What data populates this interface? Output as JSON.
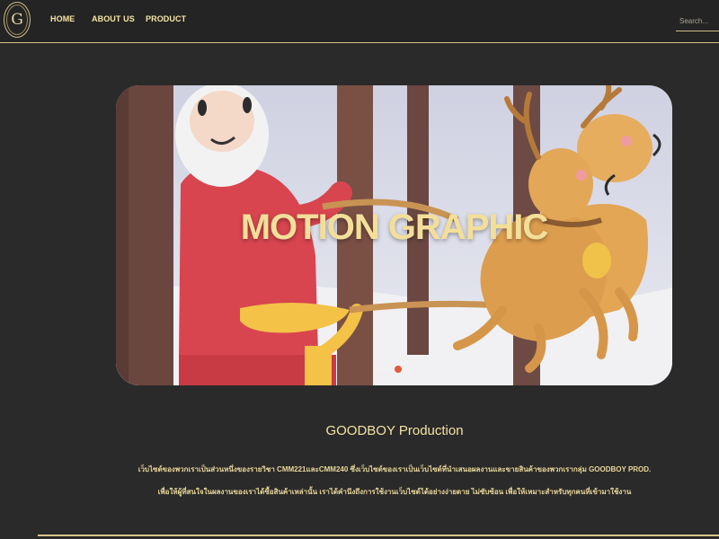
{
  "brand": {
    "logo_text": "G"
  },
  "nav": {
    "home": "HOME",
    "about": "ABOUT US",
    "product": "PRODUCT",
    "search_placeholder": "Search..."
  },
  "hero": {
    "title": "MOTION GRAPHIC",
    "slides": 4,
    "active_slide": 3
  },
  "section": {
    "title": "GOODBOY Production",
    "line1": "เว็บไซต์ของพวกเราเป็นส่วนหนึ่งของรายวิชา CMM221และCMM240 ซึ่งเว็บไซต์ของเราเป็นเว็บไซต์ที่นำเสนอผลงานและขายสินค้าของพวกเรากลุ่ม GOODBOY PROD.",
    "line2": "เพื่อให้ผู้ที่สนใจในผลงานของเราได้ซื้อสินค้าเหล่านั้น เราได้คำนึงถึงการใช้งานเว็บไซต์ได้อย่างง่ายดาย ไม่ซับซ้อน เพื่อให้เหมาะสำหรับทุกคนที่เข้ามาใช้งาน"
  },
  "colors": {
    "background": "#2a2a2a",
    "nav_background": "#242424",
    "gold": "#f4e3a3",
    "accent_dot": "#e05a3a"
  }
}
